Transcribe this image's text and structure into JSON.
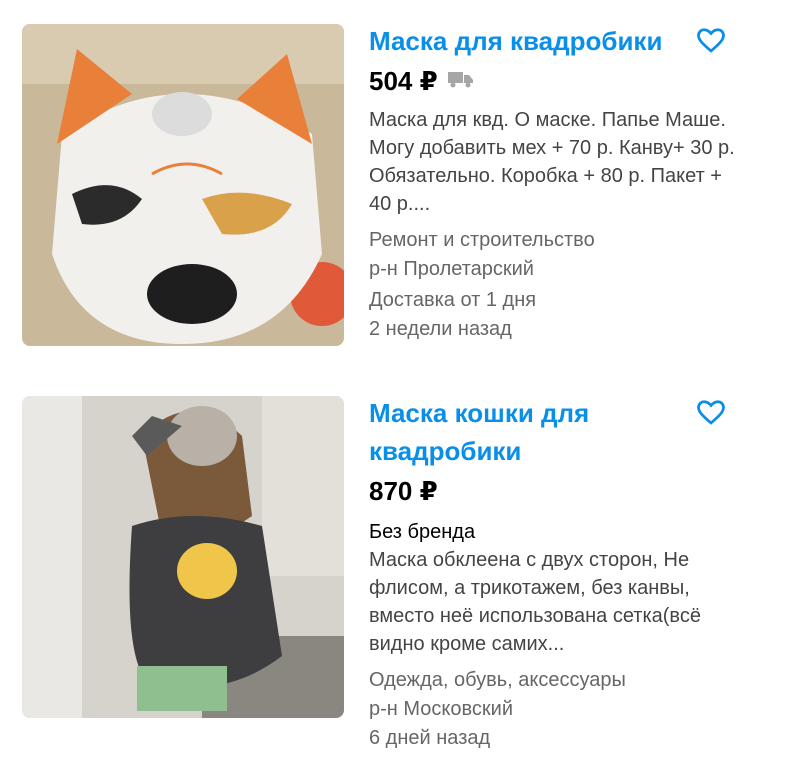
{
  "listings": [
    {
      "title": "Маска для квадробики",
      "price": "504 ₽",
      "description": "Маска для квд. О маске. Папье Маше. Могу добавить мех + 70 р. Канву+ 30 р. Обязательно. Коробка + 80 р. Пакет + 40 р....",
      "category": "Ремонт и строительство",
      "district": "р-н Пролетарский",
      "delivery": "Доставка от 1 дня",
      "posted": "2 недели назад",
      "icons": {
        "favorite": "heart-outline-icon",
        "delivery": "truck-icon"
      }
    },
    {
      "title": "Маска кошки для квадробики",
      "price": "870 ₽",
      "brand": "Без бренда",
      "description": "Маска обклеена с двух сторон, Не флисом, а трикотажем, без канвы, вместо неё использована сетка(всё видно кроме самих...",
      "category": "Одежда, обувь, аксессуары",
      "district": "р-н Московский",
      "posted": "6 дней назад",
      "icons": {
        "favorite": "heart-outline-icon"
      }
    }
  ],
  "colors": {
    "title": "#0a8fe8",
    "favorite": "#0a8fe8",
    "meta": "#666666",
    "delivery_icon": "#a6a6a6"
  }
}
